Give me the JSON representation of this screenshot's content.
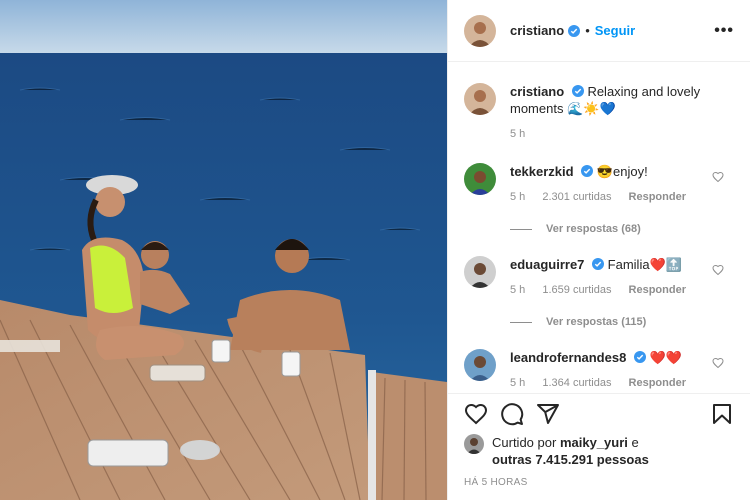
{
  "post": {
    "author": "cristiano",
    "follow_label": "Seguir",
    "separator": "•",
    "more_label": "•••"
  },
  "caption": {
    "user": "cristiano",
    "text": "Relaxing and lovely moments",
    "emoji": "🌊☀️💙",
    "time": "5 h"
  },
  "comments": [
    {
      "user": "tekkerzkid",
      "text": "😎enjoy!",
      "time": "5 h",
      "likes": "2.301 curtidas",
      "reply": "Responder",
      "replies": "Ver respostas (68)"
    },
    {
      "user": "eduaguirre7",
      "text": "Familia❤️🔝",
      "time": "5 h",
      "likes": "1.659 curtidas",
      "reply": "Responder",
      "replies": "Ver respostas (115)"
    },
    {
      "user": "leandrofernandes8",
      "text": "❤️❤️",
      "time": "5 h",
      "likes": "1.364 curtidas",
      "reply": "Responder"
    }
  ],
  "likes_summary": {
    "prefix": "Curtido por",
    "user": "maiky_yuri",
    "mid": "e",
    "others": "outras 7.415.291 pessoas"
  },
  "posted_ago": "HÁ 5 HORAS",
  "colors": {
    "accent": "#0095f6",
    "verified": "#3897f0",
    "heart": "#ed4956",
    "sea": "#1d4f86"
  },
  "icons": [
    "heart-icon",
    "comment-icon",
    "share-icon",
    "bookmark-icon",
    "verified-badge-icon"
  ]
}
